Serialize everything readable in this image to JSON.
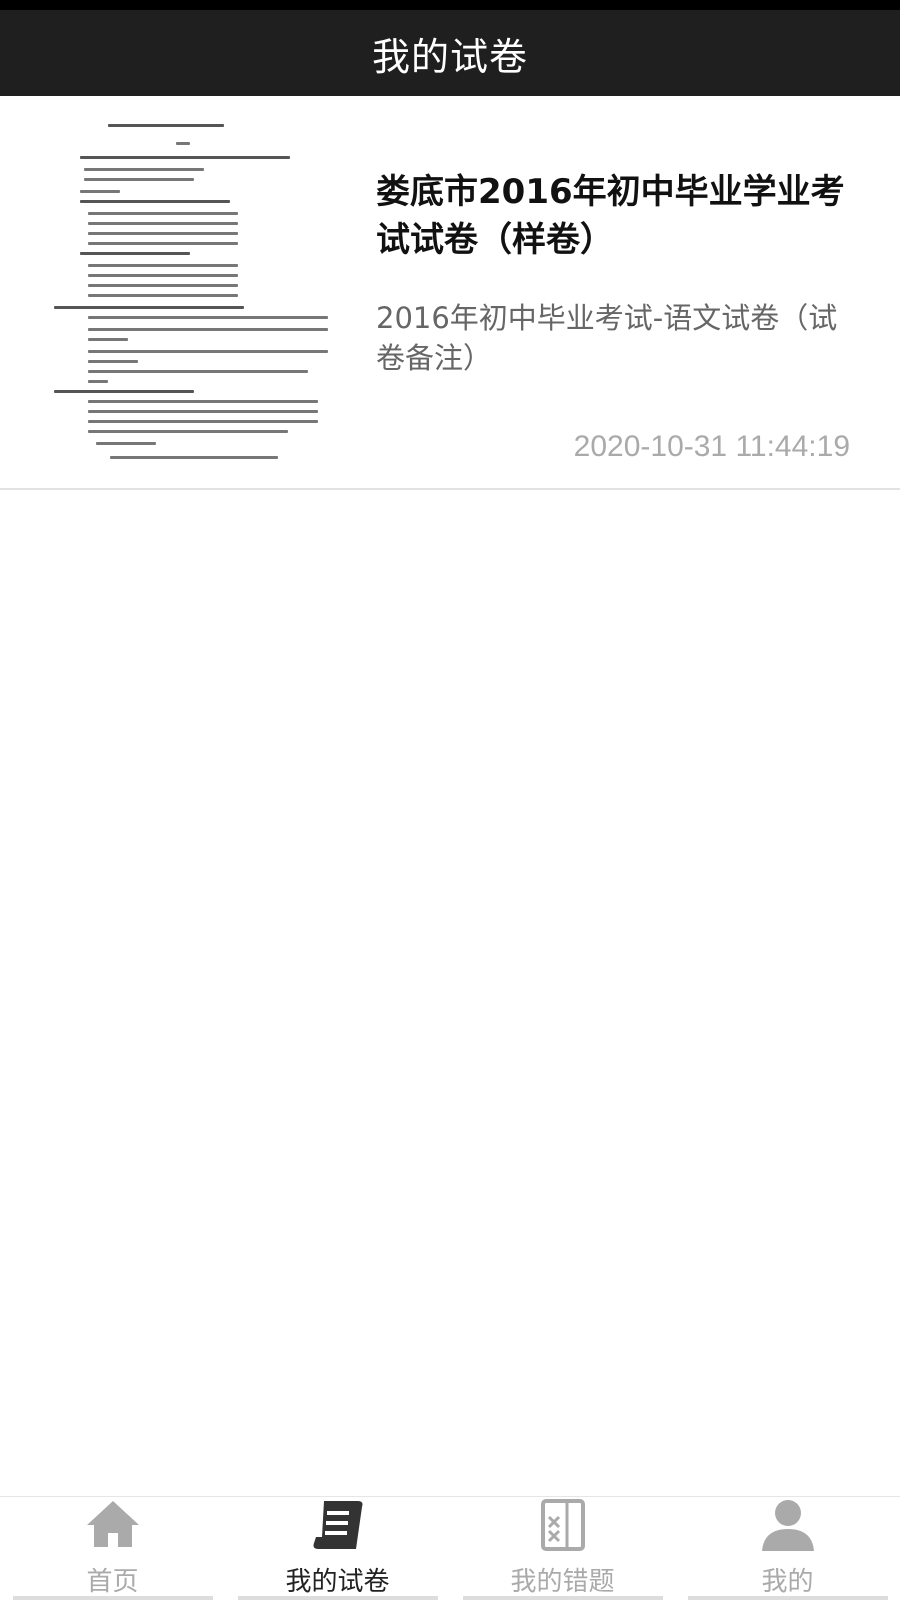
{
  "header": {
    "title": "我的试卷"
  },
  "papers": [
    {
      "title": "娄底市2016年初中毕业学业考试试卷（样卷）",
      "description": "2016年初中毕业考试-语文试卷（试卷备注）",
      "time": "2020-10-31 11:44:19",
      "thumbnail_icon": "exam-paper-thumbnail"
    }
  ],
  "tabbar": {
    "items": [
      {
        "label": "首页",
        "icon": "home-icon",
        "active": false
      },
      {
        "label": "我的试卷",
        "icon": "scroll-icon",
        "active": true
      },
      {
        "label": "我的错题",
        "icon": "wrong-questions-icon",
        "active": false
      },
      {
        "label": "我的",
        "icon": "user-icon",
        "active": false
      }
    ]
  },
  "colors": {
    "header_bg": "#1f1f1f",
    "active_tab": "#222222",
    "inactive_tab": "#aaaaaa"
  }
}
